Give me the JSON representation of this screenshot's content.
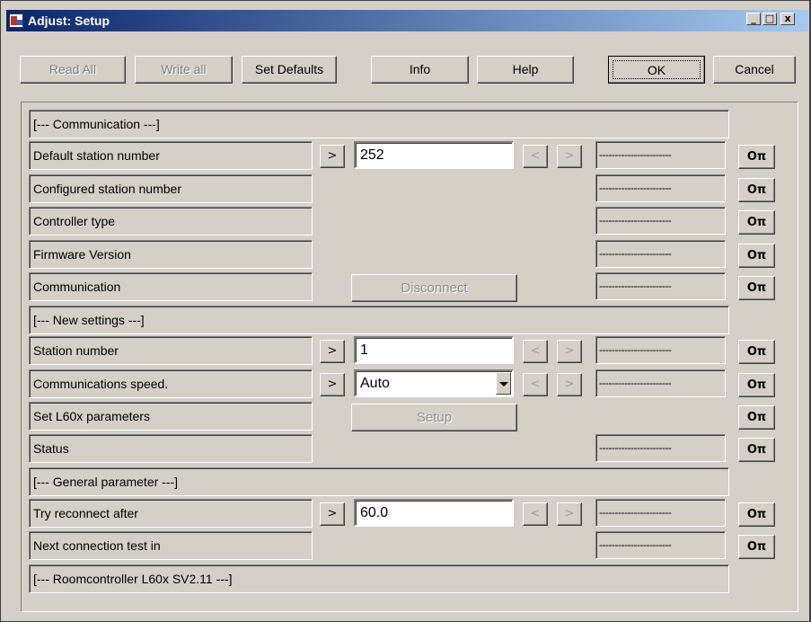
{
  "window": {
    "title": "Adjust: Setup",
    "controls": [
      "_",
      "□",
      "x"
    ]
  },
  "toolbar": {
    "read_all": "Read All",
    "write_all": "Write all",
    "set_defaults": "Set Defaults",
    "info": "Info",
    "help": "Help",
    "ok": "OK",
    "cancel": "Cancel"
  },
  "sections": {
    "communication": "[--- Communication ---]",
    "new_settings": "[--- New settings ---]",
    "general": "[--- General parameter ---]",
    "roomcontroller": "[--- Roomcontroller L60x SV2.11 ---]"
  },
  "rows": {
    "default_station": {
      "label": "Default station number",
      "value": "252",
      "status": "-----------------------"
    },
    "configured_station": {
      "label": "Configured station number",
      "status": "-----------------------"
    },
    "controller_type": {
      "label": "Controller type",
      "status": "-----------------------"
    },
    "firmware": {
      "label": "Firmware Version",
      "status": "-----------------------"
    },
    "communication": {
      "label": "Communication",
      "button": "Disconnect",
      "status": "-----------------------"
    },
    "station_number": {
      "label": "Station number",
      "value": "1",
      "status": "-----------------------"
    },
    "comm_speed": {
      "label": "Communications speed.",
      "value": "Auto",
      "status": "-----------------------"
    },
    "set_l60x": {
      "label": "Set L60x parameters",
      "button": "Setup"
    },
    "status": {
      "label": "Status",
      "status": "-----------------------"
    },
    "try_reconnect": {
      "label": "Try reconnect after",
      "value": "60.0",
      "status": "-----------------------"
    },
    "next_test": {
      "label": "Next connection test in",
      "status": "-----------------------"
    }
  },
  "glyphs": {
    "arrow_right": ">",
    "arrow_left": "<",
    "key": "Oπ"
  }
}
